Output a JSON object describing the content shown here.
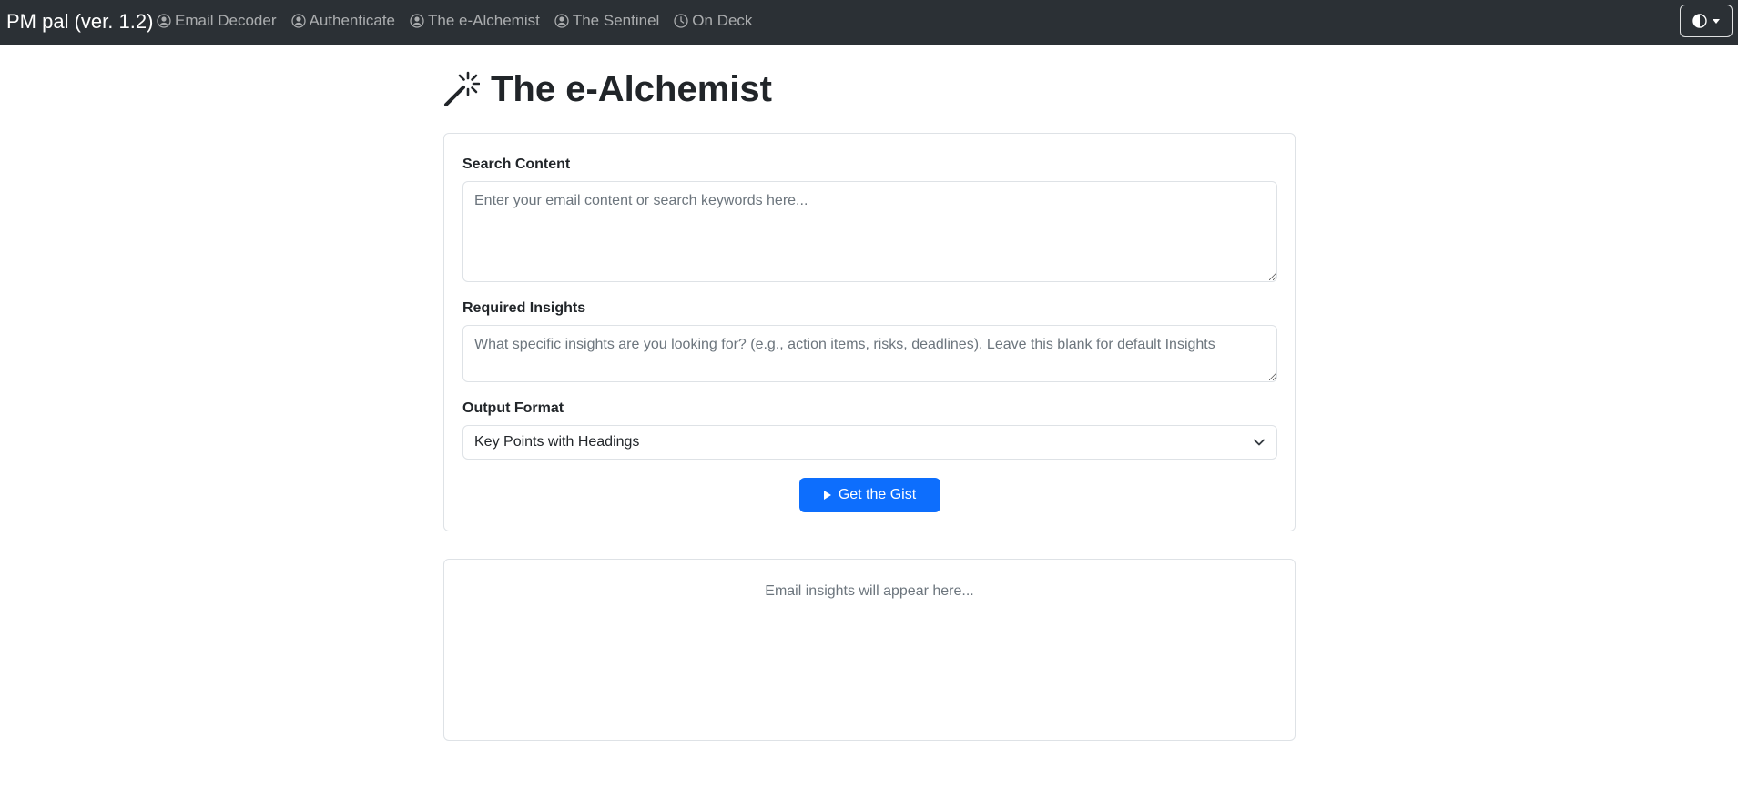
{
  "navbar": {
    "brand": "PM pal (ver. 1.2)",
    "links": [
      {
        "label": "Email Decoder",
        "icon": "person-circle-icon"
      },
      {
        "label": "Authenticate",
        "icon": "person-circle-icon"
      },
      {
        "label": "The e-Alchemist",
        "icon": "person-circle-icon"
      },
      {
        "label": "The Sentinel",
        "icon": "person-circle-icon"
      },
      {
        "label": "On Deck",
        "icon": "clock-icon"
      }
    ],
    "theme_toggle_icon": "contrast-icon"
  },
  "page": {
    "title": "The e-Alchemist",
    "title_icon": "magic-wand-icon"
  },
  "form": {
    "search_label": "Search Content",
    "search_value": "",
    "search_placeholder": "Enter your email content or search keywords here...",
    "insights_label": "Required Insights",
    "insights_value": "",
    "insights_placeholder": "What specific insights are you looking for? (e.g., action items, risks, deadlines). Leave this blank for default Insights",
    "format_label": "Output Format",
    "format_selected": "Key Points with Headings",
    "submit_label": "Get the Gist"
  },
  "output": {
    "placeholder": "Email insights will appear here..."
  },
  "colors": {
    "navbar_bg": "#2b3035",
    "primary": "#0d6efd",
    "border": "#dee2e6",
    "muted_text": "#6c757d"
  }
}
